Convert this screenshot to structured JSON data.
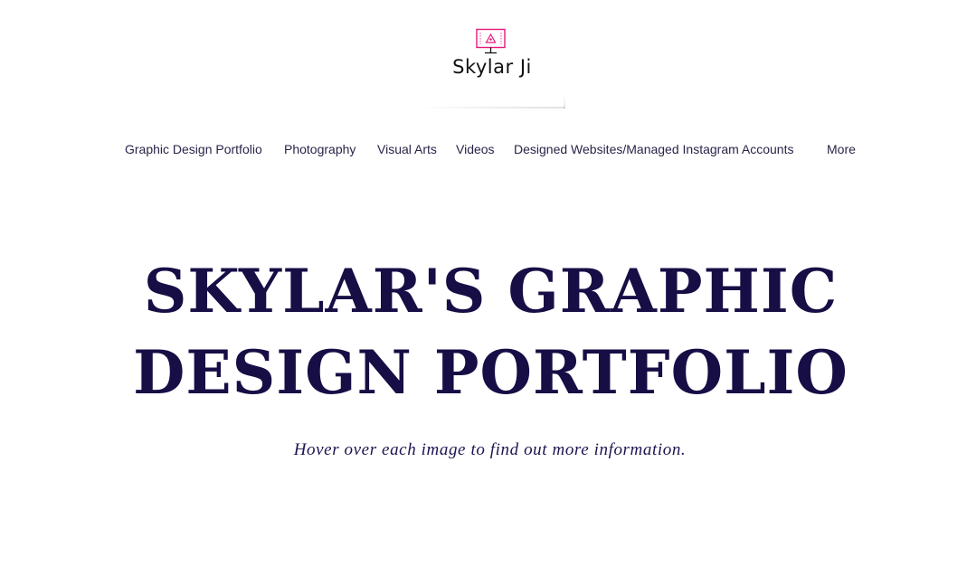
{
  "brand": {
    "name": "Skylar Ji",
    "icon": "monitor-design-icon",
    "accent_color": "#e6197a"
  },
  "nav": {
    "items": [
      {
        "label": "Graphic Design Portfolio"
      },
      {
        "label": "Photography"
      },
      {
        "label": "Visual Arts"
      },
      {
        "label": "Videos"
      },
      {
        "label": "Designed Websites/Managed Instagram Accounts"
      },
      {
        "label": "More"
      }
    ],
    "text_color": "#2a2448"
  },
  "hero": {
    "title_line1": "SKYLAR'S GRAPHIC",
    "title_line2": "DESIGN PORTFOLIO",
    "subtitle": "Hover over each image to find out more information.",
    "title_color": "#160e45"
  }
}
